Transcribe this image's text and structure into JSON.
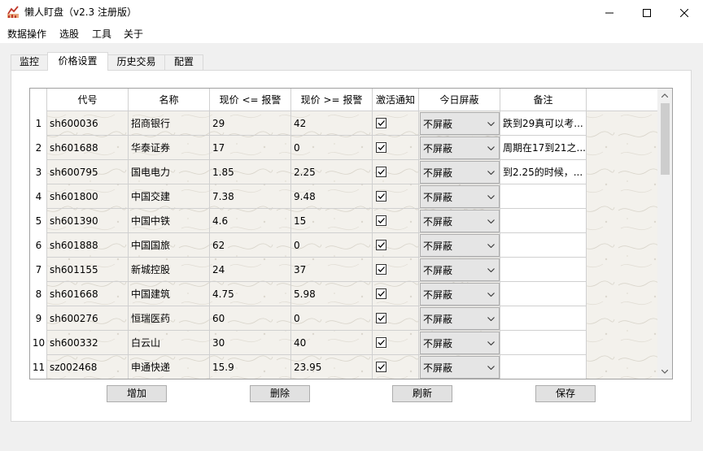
{
  "window": {
    "title": "懒人盯盘（v2.3 注册版）"
  },
  "menu": [
    "数据操作",
    "选股",
    "工具",
    "关于"
  ],
  "tabs": [
    {
      "label": "监控",
      "active": false
    },
    {
      "label": "价格设置",
      "active": true
    },
    {
      "label": "历史交易",
      "active": false
    },
    {
      "label": "配置",
      "active": false
    }
  ],
  "table": {
    "headers": [
      "代号",
      "名称",
      "现价 <= 报警",
      "现价 >= 报警",
      "激活通知",
      "今日屏蔽",
      "备注"
    ],
    "rows": [
      {
        "num": "1",
        "code": "sh600036",
        "name": "招商银行",
        "low": "29",
        "high": "42",
        "active": true,
        "mute": "不屏蔽",
        "note": "跌到29真可以考..."
      },
      {
        "num": "2",
        "code": "sh601688",
        "name": "华泰证券",
        "low": "17",
        "high": "0",
        "active": true,
        "mute": "不屏蔽",
        "note": "周期在17到21之..."
      },
      {
        "num": "3",
        "code": "sh600795",
        "name": "国电电力",
        "low": "1.85",
        "high": "2.25",
        "active": true,
        "mute": "不屏蔽",
        "note": "到2.25的时候，..."
      },
      {
        "num": "4",
        "code": "sh601800",
        "name": "中国交建",
        "low": "7.38",
        "high": "9.48",
        "active": true,
        "mute": "不屏蔽",
        "note": ""
      },
      {
        "num": "5",
        "code": "sh601390",
        "name": "中国中铁",
        "low": "4.6",
        "high": "15",
        "active": true,
        "mute": "不屏蔽",
        "note": ""
      },
      {
        "num": "6",
        "code": "sh601888",
        "name": "中国国旅",
        "low": "62",
        "high": "0",
        "active": true,
        "mute": "不屏蔽",
        "note": ""
      },
      {
        "num": "7",
        "code": "sh601155",
        "name": "新城控股",
        "low": "24",
        "high": "37",
        "active": true,
        "mute": "不屏蔽",
        "note": ""
      },
      {
        "num": "8",
        "code": "sh601668",
        "name": "中国建筑",
        "low": "4.75",
        "high": "5.98",
        "active": true,
        "mute": "不屏蔽",
        "note": ""
      },
      {
        "num": "9",
        "code": "sh600276",
        "name": "恒瑞医药",
        "low": "60",
        "high": "0",
        "active": true,
        "mute": "不屏蔽",
        "note": ""
      },
      {
        "num": "10",
        "code": "sh600332",
        "name": "白云山",
        "low": "30",
        "high": "40",
        "active": true,
        "mute": "不屏蔽",
        "note": ""
      },
      {
        "num": "11",
        "code": "sz002468",
        "name": "申通快递",
        "low": "15.9",
        "high": "23.95",
        "active": true,
        "mute": "不屏蔽",
        "note": ""
      }
    ]
  },
  "buttons": {
    "add": "增加",
    "delete": "删除",
    "refresh": "刷新",
    "save": "保存"
  },
  "colors": {
    "accent_icon": "#c0392b",
    "combo_bg": "#e5e5e5"
  }
}
